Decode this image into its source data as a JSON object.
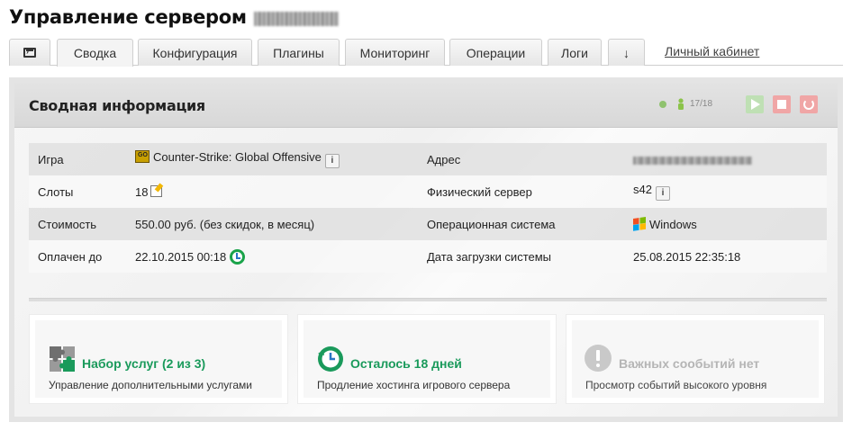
{
  "header": {
    "title": "Управление сервером"
  },
  "tabs": [
    {
      "label": "",
      "icon": "console-icon"
    },
    {
      "label": "Сводка",
      "active": true
    },
    {
      "label": "Конфигурация"
    },
    {
      "label": "Плагины"
    },
    {
      "label": "Мониторинг"
    },
    {
      "label": "Операции"
    },
    {
      "label": "Логи"
    },
    {
      "label": "↓"
    }
  ],
  "cabinet_link": "Личный кабинет",
  "panel": {
    "title": "Сводная информация",
    "status_color": "#8fc26e",
    "players": "17/18",
    "controls": [
      "play-icon",
      "stop-icon",
      "restart-icon"
    ]
  },
  "info": {
    "rows": [
      {
        "label": "Игра",
        "value": "Counter-Strike: Global Offensive",
        "label2": "Адрес",
        "value2": ""
      },
      {
        "label": "Слоты",
        "value": "18",
        "label2": "Физический сервер",
        "value2": "s42"
      },
      {
        "label": "Стоимость",
        "value": "550.00 руб. (без скидок, в месяц)",
        "label2": "Операционная система",
        "value2": "Windows"
      },
      {
        "label": "Оплачен до",
        "value": "22.10.2015 00:18",
        "label2": "Дата загрузки системы",
        "value2": "25.08.2015 22:35:18"
      }
    ]
  },
  "cards": [
    {
      "title": "Набор услуг (2 из 3)",
      "subtitle": "Управление дополнительными услугами",
      "icon": "puzzle-icon"
    },
    {
      "title": "Осталось 18 дней",
      "subtitle": "Продление хостинга игрового сервера",
      "icon": "clock-icon"
    },
    {
      "title": "Важных сообытий нет",
      "subtitle": "Просмотр событий высокого уровня",
      "icon": "warning-icon"
    }
  ],
  "colors": {
    "accent_green": "#1a9a5b",
    "stop_red": "#f0a6a6",
    "start_green": "#bfe0b4"
  }
}
